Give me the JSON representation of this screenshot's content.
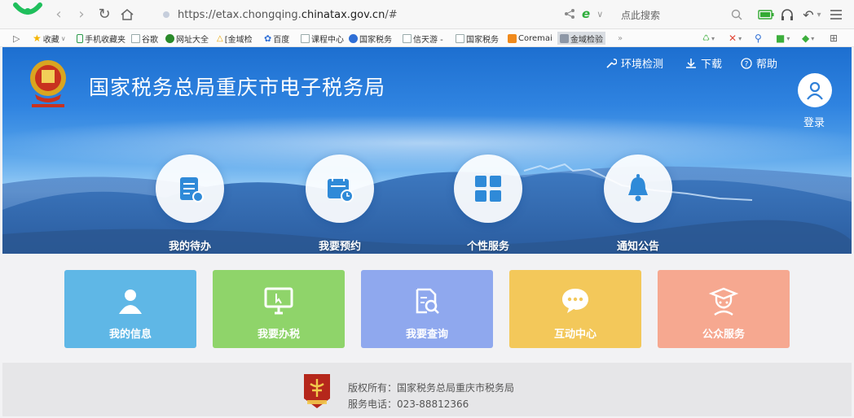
{
  "browser": {
    "url_prefix": "https://etax.chongqing.",
    "url_domain": "chinatax.gov.cn",
    "url_suffix": "/#",
    "search_placeholder": "点此搜索",
    "bookmarks": [
      {
        "label": "收藏",
        "icon": "star-icon"
      },
      {
        "label": "手机收藏夹",
        "icon": "phone-icon"
      },
      {
        "label": "谷歌",
        "icon": "doc-icon"
      },
      {
        "label": "网址大全",
        "icon": "globe-icon"
      },
      {
        "label": "[金域检",
        "icon": "triangle-icon"
      },
      {
        "label": "百度",
        "icon": "paw-icon"
      },
      {
        "label": "课程中心",
        "icon": "doc-icon"
      },
      {
        "label": "国家税务",
        "icon": "q-icon"
      },
      {
        "label": "信天游 -",
        "icon": "doc-icon"
      },
      {
        "label": "国家税务",
        "icon": "doc-icon"
      },
      {
        "label": "Coremai",
        "icon": "c-icon"
      },
      {
        "label": "金域检验",
        "icon": "image-icon"
      }
    ]
  },
  "header": {
    "title": "国家税务总局重庆市电子税务局",
    "nav": {
      "env_check": "环境检测",
      "download": "下载",
      "help": "帮助"
    },
    "login": "登录"
  },
  "quick": [
    {
      "label": "我的待办"
    },
    {
      "label": "我要预约"
    },
    {
      "label": "个性服务"
    },
    {
      "label": "通知公告"
    }
  ],
  "tiles": [
    {
      "label": "我的信息",
      "color": "#5fb7e6"
    },
    {
      "label": "我要办税",
      "color": "#8fd46a"
    },
    {
      "label": "我要查询",
      "color": "#8fa8ee"
    },
    {
      "label": "互动中心",
      "color": "#f3c85a"
    },
    {
      "label": "公众服务",
      "color": "#f6a890"
    }
  ],
  "footer": {
    "copyright": "版权所有：国家税务总局重庆市税务局",
    "phone": "服务电话：023-88812366"
  },
  "colors": {
    "banner_top": "#1d6fd0",
    "footer_bg": "#e6e6e8"
  }
}
